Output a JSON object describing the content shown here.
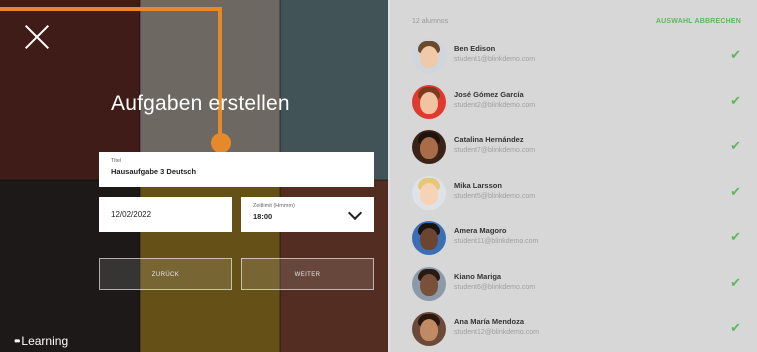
{
  "form": {
    "heading": "Aufgaben erstellen",
    "title_label": "Titel",
    "title_value": "Hausaufgabe 3 Deutsch",
    "date_value": "12/02/2022",
    "time_label": "Zeitlimit (Hmmm)",
    "time_value": "18:00",
    "back_button": "ZURÜCK",
    "next_button": "WEITER"
  },
  "brand": {
    "dots": "••",
    "name": "Learning"
  },
  "students_panel": {
    "count_label": "12 alumnos",
    "deselect_label": "AUSWAHL ABBRECHEN",
    "students": [
      {
        "name": "Ben Edison",
        "email": "student1@blinkdemo.com"
      },
      {
        "name": "José Gómez García",
        "email": "student2@blinkdemo.com"
      },
      {
        "name": "Catalina Hernández",
        "email": "student7@blinkdemo.com"
      },
      {
        "name": "Mika Larsson",
        "email": "student5@blinkdemo.com"
      },
      {
        "name": "Amera Magoro",
        "email": "student11@blinkdemo.com"
      },
      {
        "name": "Kiano Mariga",
        "email": "student6@blinkdemo.com"
      },
      {
        "name": "Ana María Mendoza",
        "email": "student12@blinkdemo.com"
      }
    ]
  },
  "colors": {
    "accent": "#5cb85c",
    "annotation": "#e5892a"
  }
}
